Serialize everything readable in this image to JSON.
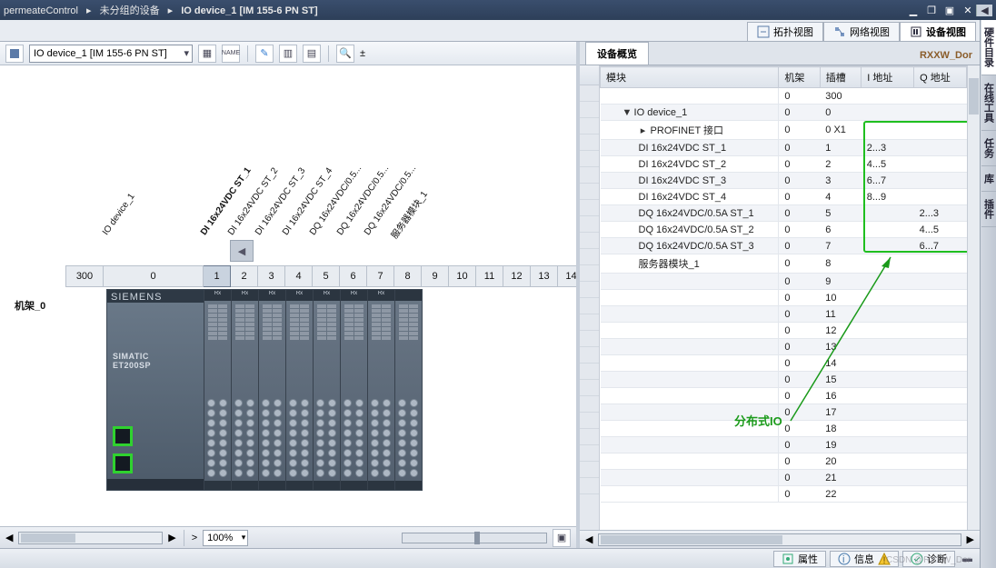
{
  "title": {
    "crumb1": "permeateControl",
    "crumb2": "未分组的设备",
    "crumb3": "IO device_1 [IM 155-6 PN ST]"
  },
  "view_tabs": {
    "topology": "拓扑视图",
    "network": "网络视图",
    "device": "设备视图"
  },
  "toolbar": {
    "device_selector": "IO device_1 [IM 155-6 PN ST]"
  },
  "zoom": {
    "value": "100%"
  },
  "rack": {
    "label": "机架_0",
    "slot_pre": "300",
    "slots": [
      "0",
      "1",
      "2",
      "3",
      "4",
      "5",
      "6",
      "7",
      "8",
      "9",
      "10",
      "11",
      "12",
      "13",
      "14"
    ],
    "device_label": "IO device_1",
    "module_labels": [
      "DI 16x24VDC ST_1",
      "DI 16x24VDC ST_2",
      "DI 16x24VDC ST_3",
      "DI 16x24VDC ST_4",
      "DQ 16x24VDC/0.5...",
      "DQ 16x24VDC/0.5...",
      "DQ 16x24VDC/0.5...",
      "服务器模块_1"
    ],
    "plc_brand": "SIEMENS",
    "plc_model": "SIMATIC\nET200SP"
  },
  "overview": {
    "tab": "设备概览",
    "brand": "RXXW_Dor",
    "headers": {
      "module": "模块",
      "rack": "机架",
      "slot": "插槽",
      "iaddr": "I 地址",
      "qaddr": "Q 地址"
    },
    "rows": [
      {
        "m": "",
        "r": "0",
        "s": "300",
        "i": "",
        "q": "",
        "ind": 0
      },
      {
        "m": "IO device_1",
        "r": "0",
        "s": "0",
        "i": "",
        "q": "",
        "ind": 1,
        "tw": "▼"
      },
      {
        "m": "PROFINET 接口",
        "r": "0",
        "s": "0 X1",
        "i": "",
        "q": "",
        "ind": 2,
        "tw": "▸"
      },
      {
        "m": "DI 16x24VDC ST_1",
        "r": "0",
        "s": "1",
        "i": "2...3",
        "q": "",
        "ind": 2
      },
      {
        "m": "DI 16x24VDC ST_2",
        "r": "0",
        "s": "2",
        "i": "4...5",
        "q": "",
        "ind": 2
      },
      {
        "m": "DI 16x24VDC ST_3",
        "r": "0",
        "s": "3",
        "i": "6...7",
        "q": "",
        "ind": 2
      },
      {
        "m": "DI 16x24VDC ST_4",
        "r": "0",
        "s": "4",
        "i": "8...9",
        "q": "",
        "ind": 2
      },
      {
        "m": "DQ 16x24VDC/0.5A ST_1",
        "r": "0",
        "s": "5",
        "i": "",
        "q": "2...3",
        "ind": 2
      },
      {
        "m": "DQ 16x24VDC/0.5A ST_2",
        "r": "0",
        "s": "6",
        "i": "",
        "q": "4...5",
        "ind": 2
      },
      {
        "m": "DQ 16x24VDC/0.5A ST_3",
        "r": "0",
        "s": "7",
        "i": "",
        "q": "6...7",
        "ind": 2
      },
      {
        "m": "服务器模块_1",
        "r": "0",
        "s": "8",
        "i": "",
        "q": "",
        "ind": 2
      },
      {
        "m": "",
        "r": "0",
        "s": "9",
        "i": "",
        "q": "",
        "ind": 2
      },
      {
        "m": "",
        "r": "0",
        "s": "10",
        "i": "",
        "q": "",
        "ind": 2
      },
      {
        "m": "",
        "r": "0",
        "s": "11",
        "i": "",
        "q": "",
        "ind": 2
      },
      {
        "m": "",
        "r": "0",
        "s": "12",
        "i": "",
        "q": "",
        "ind": 2
      },
      {
        "m": "",
        "r": "0",
        "s": "13",
        "i": "",
        "q": "",
        "ind": 2
      },
      {
        "m": "",
        "r": "0",
        "s": "14",
        "i": "",
        "q": "",
        "ind": 2
      },
      {
        "m": "",
        "r": "0",
        "s": "15",
        "i": "",
        "q": "",
        "ind": 2
      },
      {
        "m": "",
        "r": "0",
        "s": "16",
        "i": "",
        "q": "",
        "ind": 2
      },
      {
        "m": "",
        "r": "0",
        "s": "17",
        "i": "",
        "q": "",
        "ind": 2
      },
      {
        "m": "",
        "r": "0",
        "s": "18",
        "i": "",
        "q": "",
        "ind": 2
      },
      {
        "m": "",
        "r": "0",
        "s": "19",
        "i": "",
        "q": "",
        "ind": 2
      },
      {
        "m": "",
        "r": "0",
        "s": "20",
        "i": "",
        "q": "",
        "ind": 2
      },
      {
        "m": "",
        "r": "0",
        "s": "21",
        "i": "",
        "q": "",
        "ind": 2
      },
      {
        "m": "",
        "r": "0",
        "s": "22",
        "i": "",
        "q": "",
        "ind": 2
      }
    ],
    "annotation": "分布式IO"
  },
  "status_tabs": {
    "props": "属性",
    "info": "信息",
    "diag": "诊断"
  },
  "side_panels": [
    "硬件目录",
    "在线工具",
    "任务",
    "库",
    "插件"
  ],
  "watermark": "CSDN @RXXW_Dor"
}
